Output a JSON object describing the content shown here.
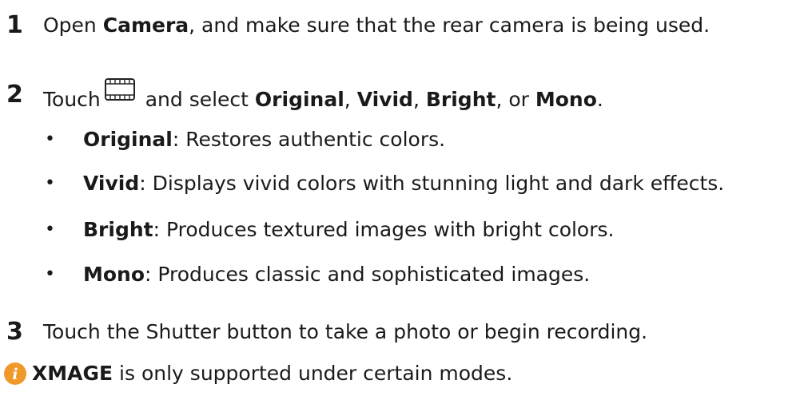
{
  "steps": [
    {
      "number": "1",
      "before": "Open ",
      "bold": "Camera",
      "after": ", and make sure that the rear camera is being used."
    },
    {
      "number": "2",
      "before": "Touch",
      "icon": "filter-film-icon",
      "middle": " and select ",
      "opt1": "Original",
      "sep1": ", ",
      "opt2": "Vivid",
      "sep2": ", ",
      "opt3": "Bright",
      "sep3": ", or ",
      "opt4": "Mono",
      "end": "."
    },
    {
      "number": "3",
      "text": "Touch the Shutter button to take a photo or begin recording."
    }
  ],
  "bullets": [
    {
      "dot": "•",
      "term": "Original",
      "desc": ": Restores authentic colors."
    },
    {
      "dot": "•",
      "term": "Vivid",
      "desc": ": Displays vivid colors with stunning light and dark effects."
    },
    {
      "dot": "•",
      "term": "Bright",
      "desc": ": Produces textured images with bright colors."
    },
    {
      "dot": "•",
      "term": "Mono",
      "desc": ": Produces classic and sophisticated images."
    }
  ],
  "note": {
    "icon": "info-icon",
    "bold": "XMAGE",
    "text": " is only supported under certain modes.",
    "icon_color": "#f0992a"
  }
}
